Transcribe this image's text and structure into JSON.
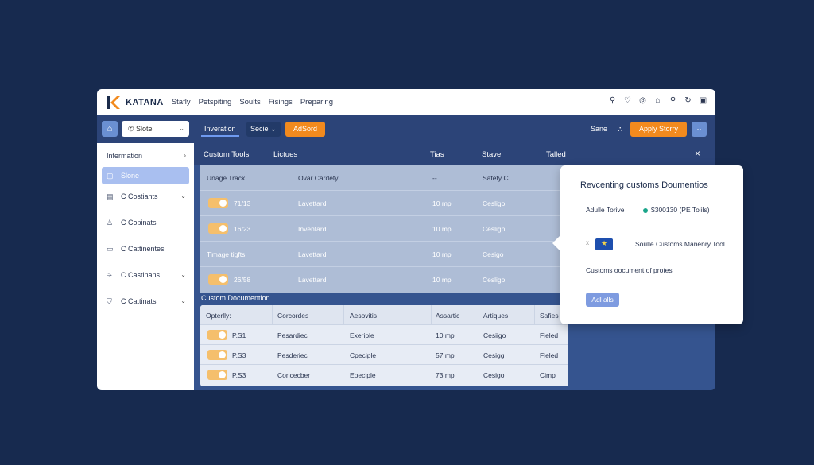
{
  "app": {
    "brand": "KATANA",
    "top_nav": [
      "Stafly",
      "Petspiting",
      "Soults",
      "Fisings",
      "Preparing"
    ],
    "top_icons": [
      "search-icon",
      "heart-icon",
      "target-icon",
      "bag-icon",
      "search-icon",
      "refresh-icon",
      "lock-icon"
    ]
  },
  "toolbar": {
    "store_value": "Slote",
    "tab_active": "Inveration",
    "select_label": "Secie",
    "add_label": "AdSord",
    "save_label": "Sane",
    "apply_label": "Apply Storry",
    "more_label": "··"
  },
  "sidebar": {
    "items": [
      {
        "label": "Infermation",
        "icon": "",
        "chevron": "›"
      },
      {
        "label": "Slone",
        "icon": "",
        "chevron": ""
      },
      {
        "label": "C Costiants",
        "icon": "▤",
        "chevron": "⌄"
      },
      {
        "label": "C Copinats",
        "icon": "♙",
        "chevron": ""
      },
      {
        "label": "C Cattinentes",
        "icon": "▭",
        "chevron": ""
      },
      {
        "label": "C Castinans",
        "icon": "⌲",
        "chevron": "⌄"
      },
      {
        "label": "C Cattinats",
        "icon": "⛉",
        "chevron": "⌄"
      }
    ]
  },
  "panel": {
    "headers": [
      "Custom Tools",
      "Lictues",
      "Tias",
      "Stave",
      "Talled"
    ],
    "close": "×"
  },
  "table1": {
    "header": [
      "Unage Track",
      "Ovar Cardety",
      "--",
      "Safety C"
    ],
    "rows": [
      {
        "c1": "71/13",
        "c2": "Lavettard",
        "c3": "10 mp",
        "c4": "Cesligo",
        "toggle": true
      },
      {
        "c1": "16/23",
        "c2": "Inventard",
        "c3": "10 mp",
        "c4": "Cesligp",
        "toggle": true
      },
      {
        "c1": "Timage tigfts",
        "c2": "Lavettard",
        "c3": "10 mp",
        "c4": "Cesigo",
        "toggle": false
      },
      {
        "c1": "26/58",
        "c2": "Lavettard",
        "c3": "10 mp",
        "c4": "Cesligo",
        "toggle": true
      }
    ]
  },
  "section2": {
    "title": "Custom Documention",
    "header": [
      "Opterlly:",
      "Corcordes",
      "Aesovitis",
      "Assartic",
      "Artiques",
      "Safies"
    ],
    "rows": [
      {
        "c1": "P.S1",
        "c2": "Pesardiec",
        "c3": "Exeriple",
        "c4": "10 mp",
        "c5": "Cesiigo",
        "c6": "Fieled"
      },
      {
        "c1": "P.S3",
        "c2": "Pesderiec",
        "c3": "Cpeciple",
        "c4": "57 mp",
        "c5": "Cesigg",
        "c6": "Fleled"
      },
      {
        "c1": "P.S3",
        "c2": "Concecber",
        "c3": "Epeciple",
        "c4": "73 mp",
        "c5": "Cesigo",
        "c6": "Cimp"
      }
    ]
  },
  "popup": {
    "title": "Revcenting customs Doumentios",
    "label1": "Adulle Torive",
    "value1": "$300130 (PE Tolils)",
    "flag_x": "x",
    "tool_text": "Soulle Customs Manenry Tool",
    "desc": "Customs oocument of protes",
    "add_label": "Adl alls",
    "status_color": "#1aa58a"
  }
}
